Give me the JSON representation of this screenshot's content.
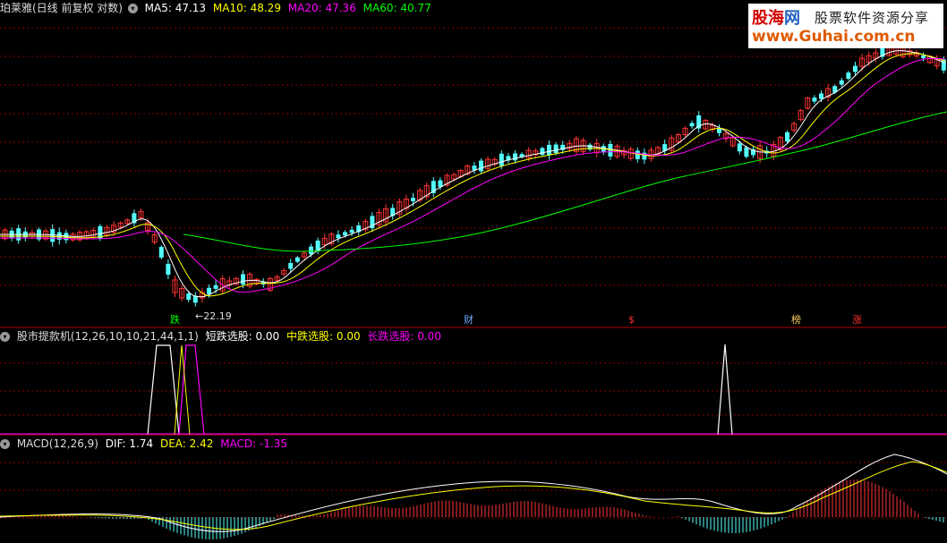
{
  "main_panel": {
    "title": "珀莱雅(日线 前复权 对数)",
    "ma_labels": [
      {
        "text": "MA5: 47.13",
        "color": "#ffffff"
      },
      {
        "text": "MA10: 48.29",
        "color": "#ffff00"
      },
      {
        "text": "MA20: 47.36",
        "color": "#ff00ff"
      },
      {
        "text": "MA60: 40.77",
        "color": "#00ff00"
      }
    ],
    "low_price_label": "22.19",
    "markers": [
      {
        "text": "跌",
        "color": "#00ff00"
      },
      {
        "text": "财",
        "color": "#6fa8ff"
      },
      {
        "text": "$",
        "color": "#ff3333"
      },
      {
        "text": "榜",
        "color": "#ffcc66"
      },
      {
        "text": "涨",
        "color": "#ff3333"
      }
    ]
  },
  "indicator_panel": {
    "title": "股市提款机(12,26,10,10,21,44,1,1)",
    "values": [
      {
        "text": "短跌选股: 0.00",
        "color": "#ffffff"
      },
      {
        "text": "中跌选股: 0.00",
        "color": "#ffff00"
      },
      {
        "text": "长跌选股: 0.00",
        "color": "#ff00ff"
      }
    ]
  },
  "macd_panel": {
    "title": "MACD(12,26,9)",
    "values": [
      {
        "text": "DIF: 1.74",
        "color": "#ffffff"
      },
      {
        "text": "DEA: 2.42",
        "color": "#ffff00"
      },
      {
        "text": "MACD: -1.35",
        "color": "#ff00ff"
      }
    ]
  },
  "logo": {
    "brand_red": "股海",
    "brand_blue": "网",
    "tagline": "股票软件资源分享",
    "url": "www.Guhai.com.cn"
  },
  "colors": {
    "up": "#ff3333",
    "down": "#54ffff",
    "grid": "#8b0000",
    "panel_border": "#b00000"
  }
}
